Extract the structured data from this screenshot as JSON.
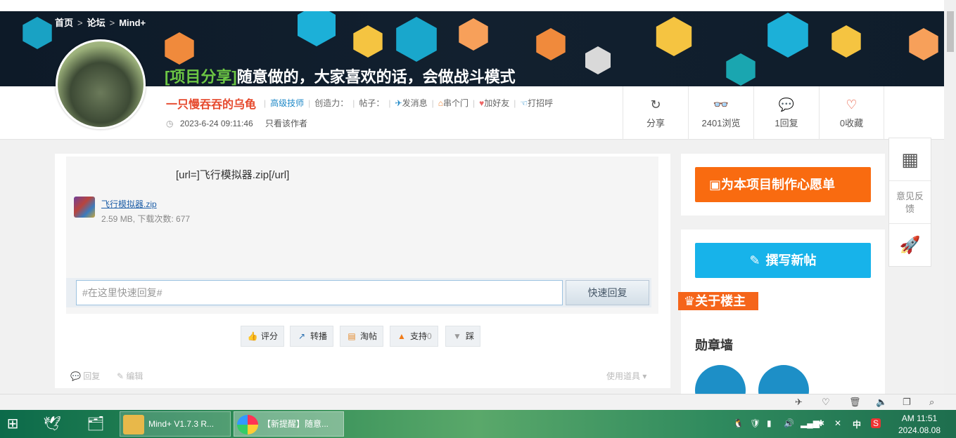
{
  "breadcrumb": {
    "home": "首页",
    "forum": "论坛",
    "section": "Mind+",
    "sep": ">"
  },
  "post": {
    "tag": "[项目分享]",
    "title": "随意做的，大家喜欢的话，会做战斗模式"
  },
  "author": {
    "name": "一只慢吞吞的乌龟",
    "rank": "高级技师",
    "creativity_label": "创造力：",
    "posts_label": "帖子：",
    "send_msg": "发消息",
    "visit": "串个门",
    "add_friend": "加好友",
    "greet": "打招呼",
    "date": "2023-6-24 09:11:46",
    "only_author": "只看该作者"
  },
  "stats": {
    "share": "分享",
    "views": "2401浏览",
    "replies": "1回复",
    "favorites": "0收藏"
  },
  "content": {
    "url_text": "[url=]飞行模拟器.zip[/url]",
    "attachment_name": "飞行模拟器.zip",
    "attachment_meta": "2.59 MB, 下载次数: 677"
  },
  "reply": {
    "placeholder": "#在这里快速回复#",
    "button": "快速回复"
  },
  "actions": {
    "rate": "评分",
    "repost": "转播",
    "taotie": "淘帖",
    "support": "支持",
    "support_count": "0",
    "oppose": "踩"
  },
  "footer": {
    "reply": "回复",
    "edit": "编辑",
    "tools": "使用道具"
  },
  "sidebar": {
    "wish_button": "为本项目制作心愿单",
    "write_button": "撰写新帖",
    "owner_tag": "关于楼主",
    "medal_wall": "勋章墙"
  },
  "floatbar": {
    "feedback": "意见反馈"
  },
  "taskbar": {
    "task1": "Mind+ V1.7.3 R...",
    "task2": "【新提醒】随意...",
    "ime": "中",
    "time": "AM 11:51",
    "date": "2024.08.08"
  },
  "colors": {
    "accent_orange": "#f96b10",
    "accent_blue": "#17b3ea",
    "author_red": "#e64a2e",
    "tag_green": "#6cc644"
  }
}
